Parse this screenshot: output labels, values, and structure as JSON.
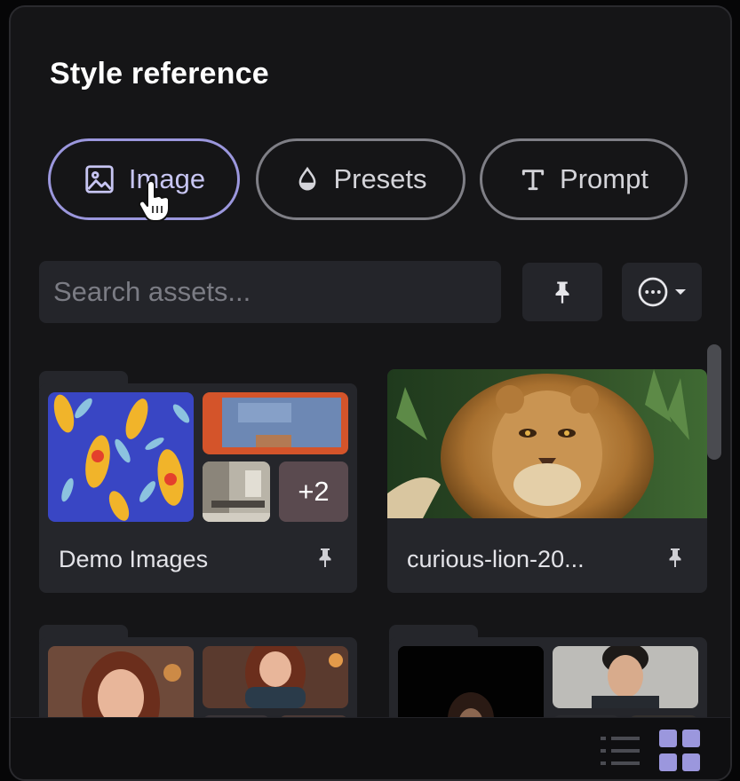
{
  "panel": {
    "title": "Style reference"
  },
  "tabs": [
    {
      "label": "Image",
      "icon": "image-icon",
      "active": true
    },
    {
      "label": "Presets",
      "icon": "drop-icon",
      "active": false
    },
    {
      "label": "Prompt",
      "icon": "text-t-icon",
      "active": false
    }
  ],
  "search": {
    "placeholder": "Search assets..."
  },
  "toolbar": {
    "pin_icon": "pin-icon",
    "more_icon": "more-horizontal-icon"
  },
  "assets": [
    {
      "label": "Demo Images",
      "type": "folder",
      "extra_count": "+2"
    },
    {
      "label": "curious-lion-20...",
      "type": "image"
    },
    {
      "label": "",
      "type": "folder"
    },
    {
      "label": "",
      "type": "folder"
    }
  ],
  "view_toggle": {
    "list_icon": "list-view-icon",
    "grid_icon": "grid-view-icon",
    "selected": "grid"
  },
  "colors": {
    "accent": "#9b97dd",
    "panel_bg": "#151517",
    "card_bg": "#25262b"
  }
}
